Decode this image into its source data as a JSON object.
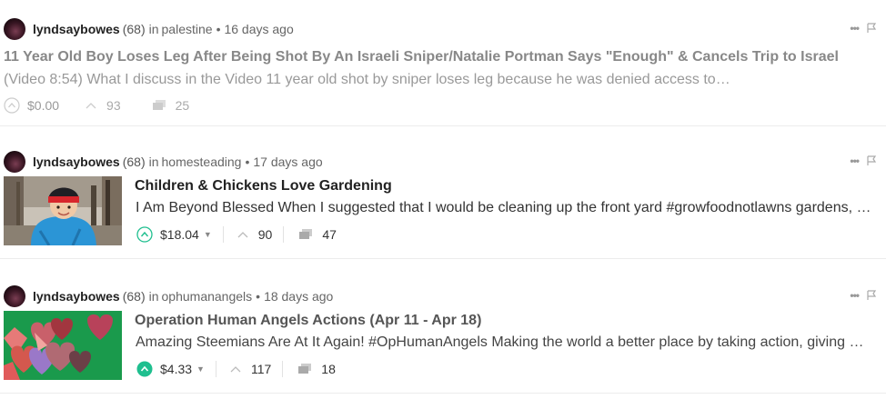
{
  "posts": [
    {
      "author": "lyndsaybowes",
      "reputation": "(68)",
      "in_label": "in",
      "community": "palestine",
      "separator": "•",
      "age": "16 days ago",
      "title": "11 Year Old Boy Loses Leg After Being Shot By An Israeli Sniper/Natalie Portman Says \"Enough\" & Cancels Trip to Israel",
      "summary": "(Video 8:54) What I discuss in the Video 11 year old shot by sniper loses leg because he was denied access to…",
      "payout": "$0.00",
      "votes": "93",
      "comments": "25",
      "more_icon": "ellipsis-icon",
      "flag_icon": "flag-icon"
    },
    {
      "author": "lyndsaybowes",
      "reputation": "(68)",
      "in_label": "in",
      "community": "homesteading",
      "separator": "•",
      "age": "17 days ago",
      "title": "Children & Chickens Love Gardening",
      "summary": "I Am Beyond Blessed When I suggested that I would be cleaning up the front yard #growfoodnotlawns gardens, …",
      "payout": "$18.04",
      "votes": "90",
      "comments": "47",
      "thumbnail": "child-in-blue-jacket-photo"
    },
    {
      "author": "lyndsaybowes",
      "reputation": "(68)",
      "in_label": "in",
      "community": "ophumanangels",
      "separator": "•",
      "age": "18 days ago",
      "title": "Operation Human Angels Actions (Apr 11 - Apr 18)",
      "summary": "Amazing Steemians Are At It Again! #OpHumanAngels Making the world a better place by taking action, giving …",
      "payout": "$4.33",
      "votes": "117",
      "comments": "18",
      "thumbnail": "paper-hearts-photo"
    }
  ],
  "colors": {
    "upvote_active": "#1fbf8f",
    "text_dark": "#222222",
    "text_muted": "#999999"
  }
}
